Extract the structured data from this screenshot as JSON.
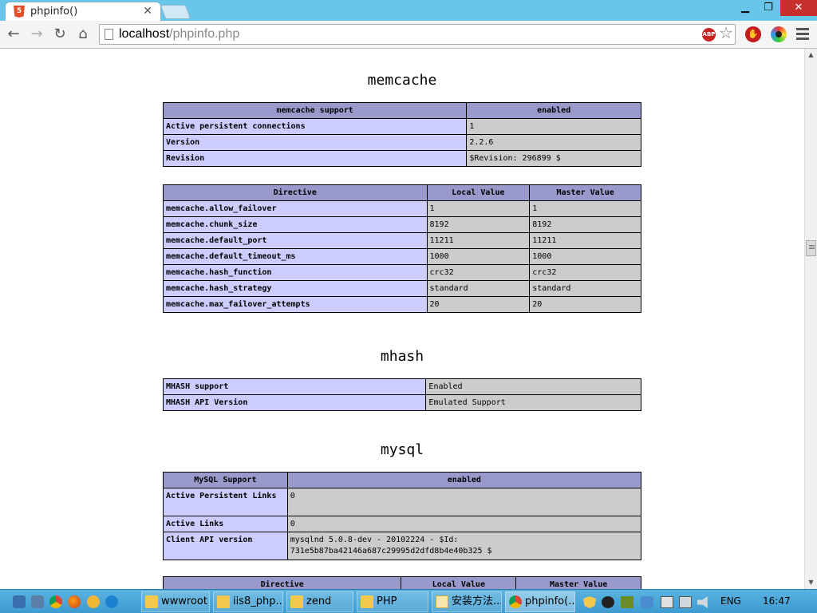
{
  "browser": {
    "tab_title": "phpinfo()",
    "tab_icon": "html5-icon",
    "url_host": "localhost",
    "url_path": "/phpinfo.php",
    "abp_label": "ABP"
  },
  "memcache": {
    "title": "memcache",
    "info_header": [
      "memcache support",
      "enabled"
    ],
    "info_rows": [
      [
        "Active persistent connections",
        "1"
      ],
      [
        "Version",
        "2.2.6"
      ],
      [
        "Revision",
        "$Revision: 296899 $"
      ]
    ],
    "directive_header": [
      "Directive",
      "Local Value",
      "Master Value"
    ],
    "directive_rows": [
      [
        "memcache.allow_failover",
        "1",
        "1"
      ],
      [
        "memcache.chunk_size",
        "8192",
        "8192"
      ],
      [
        "memcache.default_port",
        "11211",
        "11211"
      ],
      [
        "memcache.default_timeout_ms",
        "1000",
        "1000"
      ],
      [
        "memcache.hash_function",
        "crc32",
        "crc32"
      ],
      [
        "memcache.hash_strategy",
        "standard",
        "standard"
      ],
      [
        "memcache.max_failover_attempts",
        "20",
        "20"
      ]
    ]
  },
  "mhash": {
    "title": "mhash",
    "rows": [
      [
        "MHASH support",
        "Enabled"
      ],
      [
        "MHASH API Version",
        "Emulated Support"
      ]
    ]
  },
  "mysql": {
    "title": "mysql",
    "info_header": [
      "MySQL Support",
      "enabled"
    ],
    "info_rows": [
      [
        "Active Persistent Links",
        "0"
      ],
      [
        "Active Links",
        "0"
      ],
      [
        "Client API version",
        "mysqlnd 5.0.8-dev - 20102224 - $Id: 731e5b87ba42146a687c29995d2dfd8b4e40b325 $"
      ]
    ],
    "directive_header": [
      "Directive",
      "Local Value",
      "Master Value"
    ]
  },
  "taskbar": {
    "tasks": [
      {
        "label": "wwwroot",
        "icon": "folder-icon"
      },
      {
        "label": "iis8_php...",
        "icon": "folder-icon"
      },
      {
        "label": "zend",
        "icon": "folder-icon"
      },
      {
        "label": "PHP",
        "icon": "folder-icon"
      },
      {
        "label": "安装方法...",
        "icon": "document-icon"
      },
      {
        "label": "phpinfo(...",
        "icon": "chrome-icon"
      }
    ],
    "language": "ENG",
    "time": "16:47"
  },
  "colors": {
    "php_header": "#9999cc",
    "php_key": "#ccccff",
    "php_value": "#cccccc",
    "title_bar": "#6ac5ea",
    "close_button": "#c7302c"
  }
}
